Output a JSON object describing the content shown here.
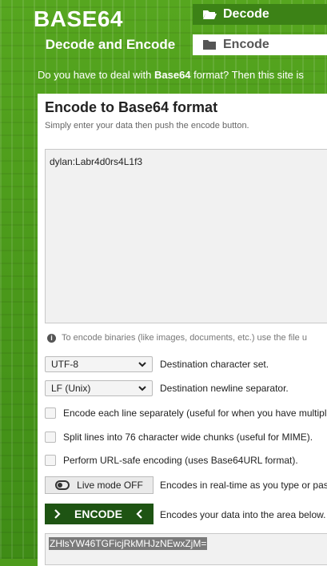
{
  "header": {
    "title": "BASE64",
    "subtitle": "Decode and Encode",
    "nav": [
      {
        "label": "Decode",
        "icon": "folder-open-icon"
      },
      {
        "label": "Encode",
        "icon": "folder-icon"
      }
    ],
    "tagline_before": "Do you have to deal with ",
    "tagline_bold": "Base64",
    "tagline_after": " format? Then this site is"
  },
  "main": {
    "heading": "Encode to Base64 format",
    "subheading": "Simply enter your data then push the encode button.",
    "input_value": "dylan:Labr4d0rs4L1f3",
    "info_text": "To encode binaries (like images, documents, etc.) use the file u",
    "charset": {
      "value": "UTF-8",
      "label": "Destination character set."
    },
    "newline": {
      "value": "LF (Unix)",
      "label": "Destination newline separator."
    },
    "options": [
      {
        "label": "Encode each line separately (useful for when you have multiple",
        "checked": false
      },
      {
        "label": "Split lines into 76 character wide chunks (useful for MIME).",
        "checked": false
      },
      {
        "label": "Perform URL-safe encoding (uses Base64URL format).",
        "checked": false
      }
    ],
    "live_mode": {
      "label": "Live mode OFF",
      "desc": "Encodes in real-time as you type or pas"
    },
    "encode": {
      "label": "ENCODE",
      "desc": "Encodes your data into the area below."
    },
    "output_value": "ZHlsYW46TGFicjRkMHJzNEwxZjM="
  },
  "colors": {
    "accent": "#4d9b1c",
    "button_dark": "#1e5413"
  }
}
